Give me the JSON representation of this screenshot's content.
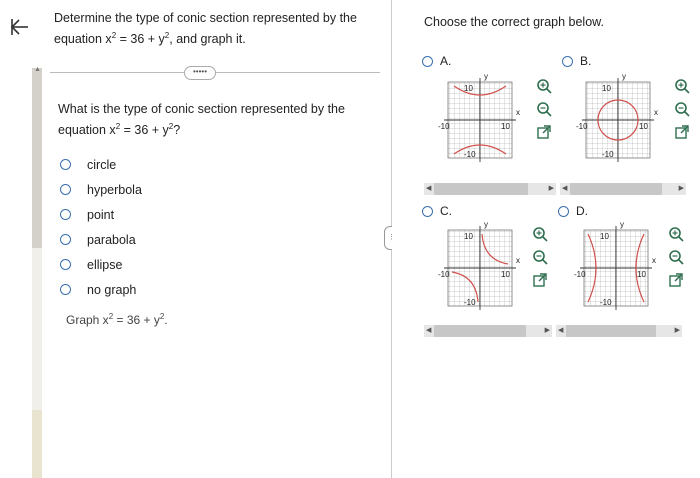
{
  "question": {
    "line1": "Determine the type of conic section represented by the",
    "line2_prefix": "equation x",
    "line2_sup1": "2",
    "line2_mid": " = 36 + y",
    "line2_sup2": "2",
    "line2_suffix": ", and graph it."
  },
  "more_label": "•••••",
  "sub_question": {
    "line1": "What is the type of conic section represented by the",
    "prefix": "equation x",
    "sup1": "2",
    "mid": " = 36 + y",
    "sup2": "2",
    "suffix": "?"
  },
  "choices": [
    "circle",
    "hyperbola",
    "point",
    "parabola",
    "ellipse",
    "no graph"
  ],
  "graph_prompt": {
    "prefix": "Graph x",
    "sup1": "2",
    "mid": " = 36 + y",
    "sup2": "2",
    "suffix": "."
  },
  "right": {
    "prompt": "Choose the correct graph below.",
    "options": [
      "A.",
      "B.",
      "C.",
      "D."
    ]
  },
  "graph_labels": {
    "y": "y",
    "x": "x",
    "ten": "10",
    "neg_ten": "-10"
  },
  "colors": {
    "radio": "#3a6fb0",
    "curve": "#d0504c",
    "tool_icon": "#2e6e4e"
  }
}
